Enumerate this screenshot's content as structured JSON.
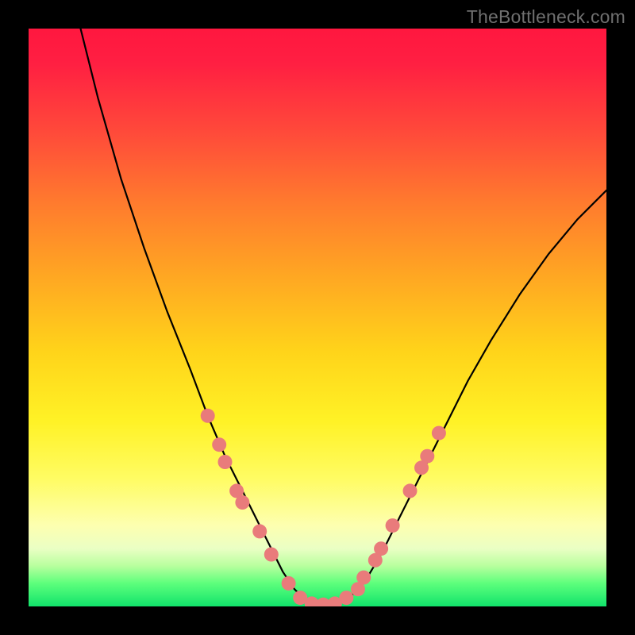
{
  "watermark": "TheBottleneck.com",
  "chart_data": {
    "type": "line",
    "title": "",
    "xlabel": "",
    "ylabel": "",
    "xlim": [
      0,
      100
    ],
    "ylim": [
      0,
      100
    ],
    "series": [
      {
        "name": "bottleneck-curve",
        "x": [
          9,
          12,
          16,
          20,
          24,
          28,
          31,
          34,
          37,
          40,
          42,
          44,
          46,
          48,
          50,
          52,
          55,
          58,
          61,
          64,
          68,
          72,
          76,
          80,
          85,
          90,
          95,
          100
        ],
        "y": [
          100,
          88,
          74,
          62,
          51,
          41,
          33,
          26,
          20,
          14,
          10,
          6,
          3,
          1,
          0,
          0,
          1,
          4,
          9,
          15,
          23,
          31,
          39,
          46,
          54,
          61,
          67,
          72
        ]
      }
    ],
    "markers": {
      "name": "highlight-points",
      "color": "#e97b7b",
      "points": [
        {
          "x": 31,
          "y": 33
        },
        {
          "x": 33,
          "y": 28
        },
        {
          "x": 34,
          "y": 25
        },
        {
          "x": 36,
          "y": 20
        },
        {
          "x": 37,
          "y": 18
        },
        {
          "x": 40,
          "y": 13
        },
        {
          "x": 42,
          "y": 9
        },
        {
          "x": 45,
          "y": 4
        },
        {
          "x": 47,
          "y": 1.5
        },
        {
          "x": 49,
          "y": 0.5
        },
        {
          "x": 51,
          "y": 0.3
        },
        {
          "x": 53,
          "y": 0.5
        },
        {
          "x": 55,
          "y": 1.5
        },
        {
          "x": 57,
          "y": 3
        },
        {
          "x": 58,
          "y": 5
        },
        {
          "x": 60,
          "y": 8
        },
        {
          "x": 61,
          "y": 10
        },
        {
          "x": 63,
          "y": 14
        },
        {
          "x": 66,
          "y": 20
        },
        {
          "x": 68,
          "y": 24
        },
        {
          "x": 69,
          "y": 26
        },
        {
          "x": 71,
          "y": 30
        }
      ]
    }
  }
}
